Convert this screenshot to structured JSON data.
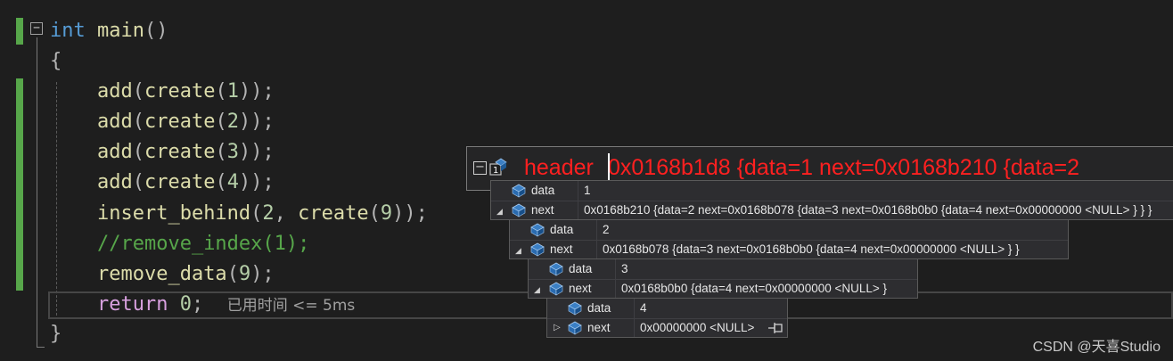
{
  "code": {
    "line1": {
      "kw": "int",
      "fn": "main",
      "punc": "()"
    },
    "open_brace": "{",
    "add_fn": "add",
    "create_fn": "create",
    "add_args": [
      "1",
      "2",
      "3",
      "4"
    ],
    "insert": {
      "fn": "insert_behind",
      "a": "2",
      "inner": "create",
      "b": "9"
    },
    "comment": "//remove_index(1);",
    "remove": {
      "fn": "remove_data",
      "arg": "9"
    },
    "ret": {
      "kw": "return",
      "val": "0",
      "semi": ";"
    },
    "perf_tip": "已用时间 <= 5ms",
    "close_brace": "}"
  },
  "tooltip": {
    "name": "header",
    "value": "0x0168b1d8 {data=1 next=0x0168b210 {data=2",
    "level1": [
      {
        "name": "data",
        "value": "1"
      },
      {
        "name": "next",
        "value": "0x0168b210 {data=2 next=0x0168b078 {data=3 next=0x0168b0b0 {data=4 next=0x00000000 <NULL> } } }"
      }
    ],
    "level2": [
      {
        "name": "data",
        "value": "2"
      },
      {
        "name": "next",
        "value": "0x0168b078 {data=3 next=0x0168b0b0 {data=4 next=0x00000000 <NULL> } }"
      }
    ],
    "level3": [
      {
        "name": "data",
        "value": "3"
      },
      {
        "name": "next",
        "value": "0x0168b0b0 {data=4 next=0x00000000 <NULL> }"
      }
    ],
    "level4": [
      {
        "name": "data",
        "value": "4"
      },
      {
        "name": "next",
        "value": "0x00000000 <NULL>"
      }
    ]
  },
  "watermark": "CSDN @天喜Studio",
  "colors": {
    "background": "#1e1e1e",
    "keyword": "#569cd6",
    "function": "#dcdcaa",
    "number": "#b5cea8",
    "comment": "#57a64a",
    "tooltip_value": "#ff2020",
    "change_bar": "#57a64a"
  }
}
